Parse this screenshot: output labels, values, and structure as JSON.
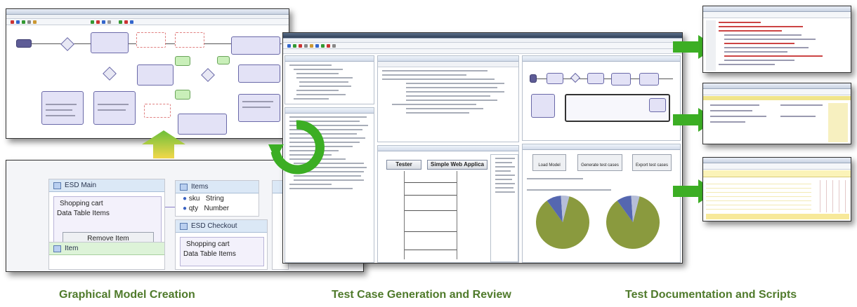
{
  "captions": {
    "model": "Graphical Model Creation",
    "generation": "Test Case Generation and Review",
    "documentation": "Test Documentation and Scripts"
  },
  "esd_main": {
    "title": "ESD Main",
    "cart_title": "Shopping cart",
    "cart_sub": "Data Table Items",
    "button": "Remove Item"
  },
  "items": {
    "title": "Items",
    "fields": [
      {
        "name": "sku",
        "type": "String"
      },
      {
        "name": "qty",
        "type": "Number"
      }
    ]
  },
  "checkout": {
    "title": "ESD Checkout",
    "cart_title": "Shopping cart",
    "cart_sub": "Data Table Items"
  },
  "item_panel": {
    "title": "Item"
  },
  "center_app": {
    "seq_buttons": [
      "Tester",
      "Simple Web Applica"
    ],
    "action_buttons": [
      "Load Model",
      "Generate test cases",
      "Export test cases"
    ],
    "pie_slices": [
      {
        "color": "#8a9a3e",
        "fraction": 0.86
      },
      {
        "color": "#5567b0",
        "fraction": 0.09
      },
      {
        "color": "#b6bed8",
        "fraction": 0.05
      }
    ]
  },
  "colors": {
    "caption_green": "#4f7a2b",
    "arrow_green": "#3cae24",
    "pie_olive": "#8a9a3e"
  },
  "icons": [
    "refresh-cycle-icon",
    "right-arrow-icon",
    "up-arrow-icon"
  ]
}
